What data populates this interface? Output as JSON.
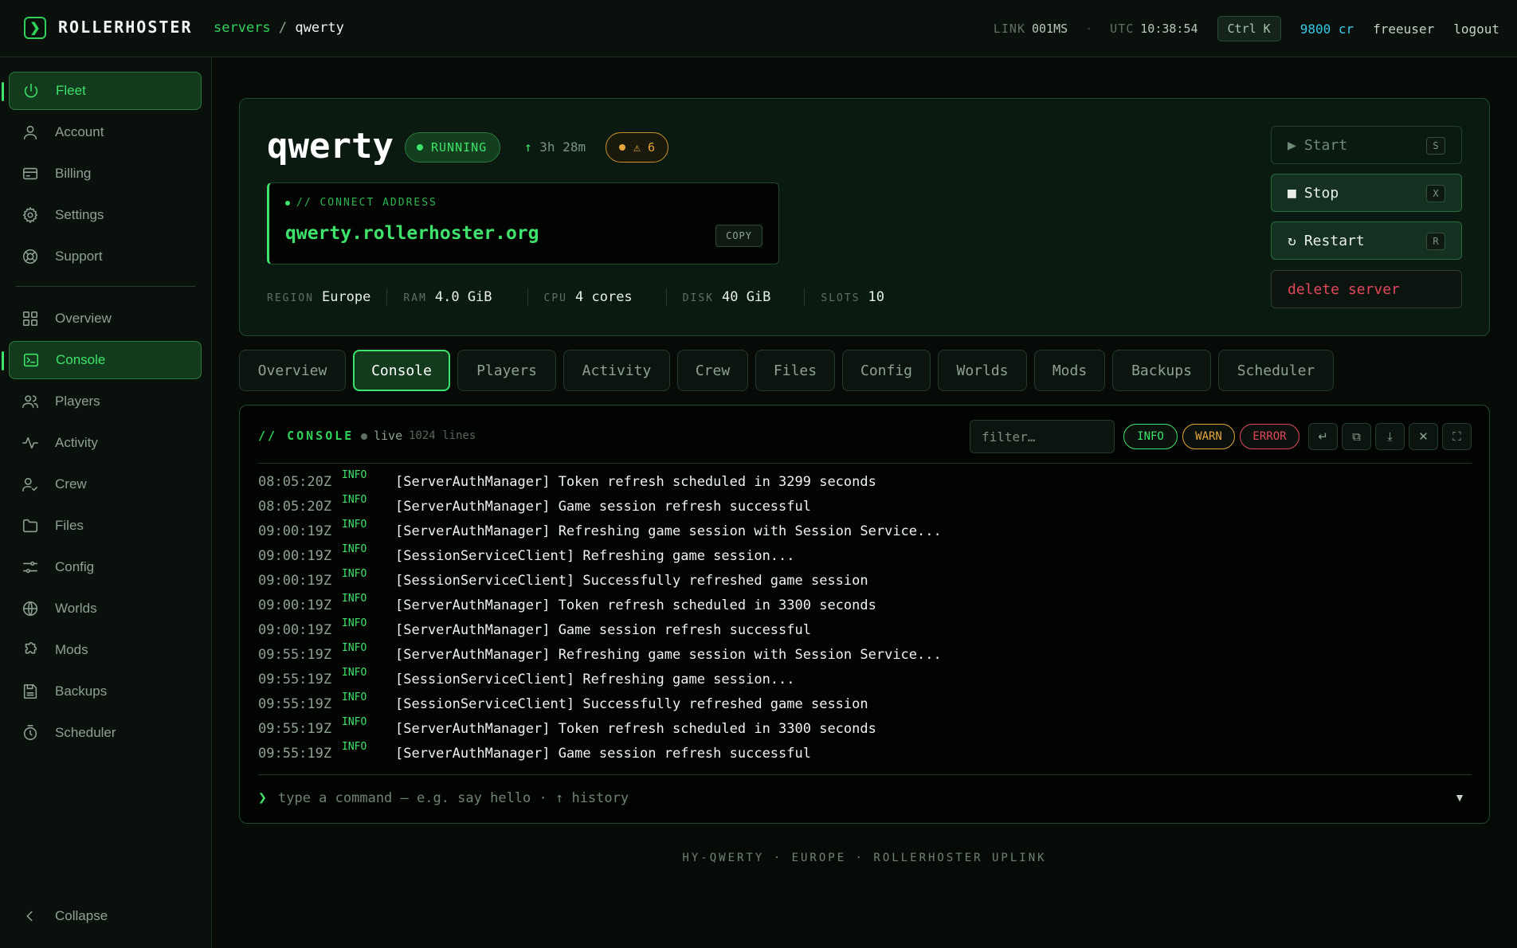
{
  "app": {
    "logo_glyph": "❯",
    "name": "ROLLERHOSTER"
  },
  "breadcrumb": {
    "parent": "servers",
    "sep": "/",
    "current": "qwerty"
  },
  "topbar": {
    "link_label": "LINK",
    "link_value": "001MS",
    "dot": "·",
    "utc_label": "UTC",
    "utc_value": "10:38:54",
    "shortcut": "Ctrl K",
    "credits": "9800 cr",
    "user": "freeuser",
    "logout": "logout"
  },
  "sidebar": {
    "primary": [
      {
        "label": "Fleet",
        "icon": "power-icon"
      },
      {
        "label": "Account",
        "icon": "user-icon"
      },
      {
        "label": "Billing",
        "icon": "card-icon"
      },
      {
        "label": "Settings",
        "icon": "gear-icon"
      },
      {
        "label": "Support",
        "icon": "lifebuoy-icon"
      }
    ],
    "secondary": [
      {
        "label": "Overview",
        "icon": "grid-icon"
      },
      {
        "label": "Console",
        "icon": "terminal-icon"
      },
      {
        "label": "Players",
        "icon": "users-icon"
      },
      {
        "label": "Activity",
        "icon": "pulse-icon"
      },
      {
        "label": "Crew",
        "icon": "user-check-icon"
      },
      {
        "label": "Files",
        "icon": "folder-icon"
      },
      {
        "label": "Config",
        "icon": "sliders-icon"
      },
      {
        "label": "Worlds",
        "icon": "globe-icon"
      },
      {
        "label": "Mods",
        "icon": "puzzle-icon"
      },
      {
        "label": "Backups",
        "icon": "save-icon"
      },
      {
        "label": "Scheduler",
        "icon": "timer-icon"
      }
    ],
    "collapse": "Collapse"
  },
  "server": {
    "name": "qwerty",
    "status": "RUNNING",
    "uptime_arrow": "↑",
    "uptime": "3h 28m",
    "warnings": "⚠ 6",
    "connect_label": "// CONNECT ADDRESS",
    "connect_address": "qwerty.rollerhoster.org",
    "copy": "COPY",
    "specs": [
      {
        "label": "REGION",
        "value": "Europe"
      },
      {
        "label": "RAM",
        "value": "4.0 GiB"
      },
      {
        "label": "CPU",
        "value": "4 cores"
      },
      {
        "label": "DISK",
        "value": "40 GiB"
      },
      {
        "label": "SLOTS",
        "value": "10"
      }
    ],
    "actions": {
      "start": {
        "glyph": "▶",
        "label": "Start",
        "key": "S"
      },
      "stop": {
        "glyph": "■",
        "label": "Stop",
        "key": "X"
      },
      "restart": {
        "glyph": "↻",
        "label": "Restart",
        "key": "R"
      },
      "delete": "delete server"
    }
  },
  "tabs": [
    "Overview",
    "Console",
    "Players",
    "Activity",
    "Crew",
    "Files",
    "Config",
    "Worlds",
    "Mods",
    "Backups",
    "Scheduler"
  ],
  "active_tab": "Console",
  "console": {
    "title": "// CONSOLE",
    "live": "live",
    "lines_count": "1024 lines",
    "filter_placeholder": "filter…",
    "levels": [
      "INFO",
      "WARN",
      "ERROR"
    ],
    "toolbar_icons": [
      "wrap-icon",
      "copy-icon",
      "download-icon",
      "clear-icon",
      "fullscreen-icon"
    ],
    "logs": [
      {
        "ts": "08:05:20Z",
        "lvl": "INFO",
        "msg": "[ServerAuthManager] Token refresh scheduled in 3299 seconds"
      },
      {
        "ts": "08:05:20Z",
        "lvl": "INFO",
        "msg": "[ServerAuthManager] Game session refresh successful"
      },
      {
        "ts": "09:00:19Z",
        "lvl": "INFO",
        "msg": "[ServerAuthManager] Refreshing game session with Session Service..."
      },
      {
        "ts": "09:00:19Z",
        "lvl": "INFO",
        "msg": "[SessionServiceClient] Refreshing game session..."
      },
      {
        "ts": "09:00:19Z",
        "lvl": "INFO",
        "msg": "[SessionServiceClient] Successfully refreshed game session"
      },
      {
        "ts": "09:00:19Z",
        "lvl": "INFO",
        "msg": "[ServerAuthManager] Token refresh scheduled in 3300 seconds"
      },
      {
        "ts": "09:00:19Z",
        "lvl": "INFO",
        "msg": "[ServerAuthManager] Game session refresh successful"
      },
      {
        "ts": "09:55:19Z",
        "lvl": "INFO",
        "msg": "[ServerAuthManager] Refreshing game session with Session Service..."
      },
      {
        "ts": "09:55:19Z",
        "lvl": "INFO",
        "msg": "[SessionServiceClient] Refreshing game session..."
      },
      {
        "ts": "09:55:19Z",
        "lvl": "INFO",
        "msg": "[SessionServiceClient] Successfully refreshed game session"
      },
      {
        "ts": "09:55:19Z",
        "lvl": "INFO",
        "msg": "[ServerAuthManager] Token refresh scheduled in 3300 seconds"
      },
      {
        "ts": "09:55:19Z",
        "lvl": "INFO",
        "msg": "[ServerAuthManager] Game session refresh successful"
      }
    ],
    "prompt_glyph": "❯",
    "command_placeholder": "type a command — e.g. say hello · ↑ history",
    "scroll_glyph": "▼"
  },
  "footer": "HY-QWERTY · EUROPE · ROLLERHOSTER UPLINK",
  "colors": {
    "accent": "#3ee36b",
    "warn": "#e6a63a",
    "error": "#e0485a",
    "credits": "#39c9e8"
  }
}
